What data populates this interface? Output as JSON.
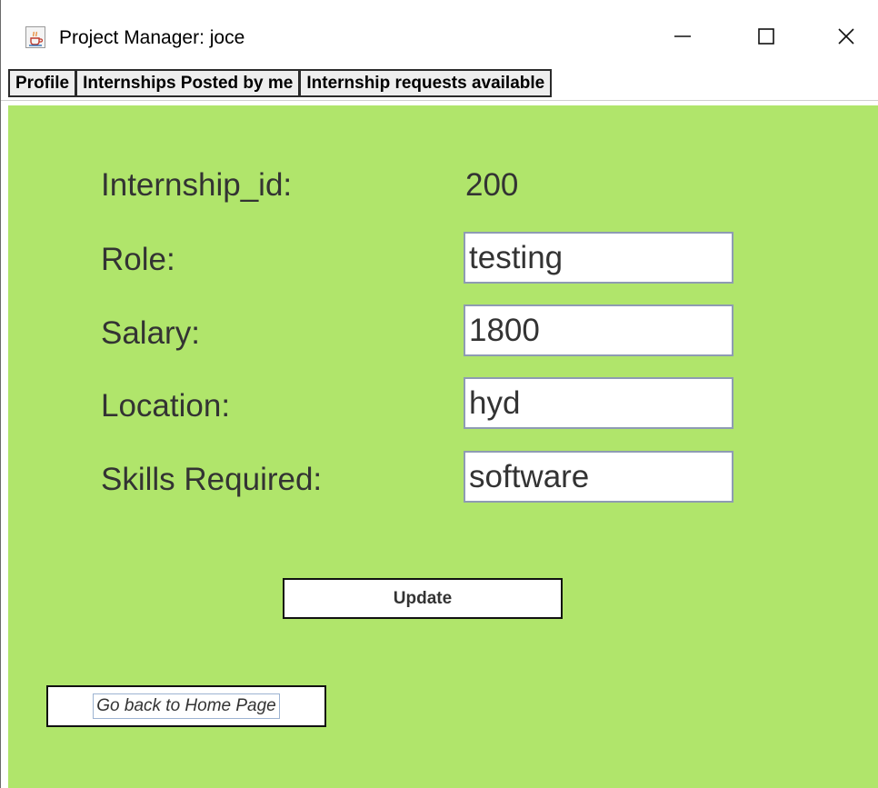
{
  "window": {
    "title": "Project Manager: joce",
    "app_icon": "java-cup-icon",
    "controls": {
      "minimize_icon": "minimize-icon",
      "maximize_icon": "maximize-icon",
      "close_icon": "close-icon"
    }
  },
  "menubar": {
    "items": [
      {
        "label": "Profile"
      },
      {
        "label": "Internships Posted by me"
      },
      {
        "label": "Internship requests available"
      }
    ]
  },
  "form": {
    "background_color": "#b0e56b",
    "internship_id": {
      "label": "Internship_id:",
      "value": "200"
    },
    "role": {
      "label": "Role:",
      "value": "testing"
    },
    "salary": {
      "label": "Salary:",
      "value": "1800"
    },
    "location": {
      "label": "Location:",
      "value": "hyd"
    },
    "skills": {
      "label": "Skills Required:",
      "value": "software"
    },
    "update_label": "Update",
    "home_label": "Go back to Home Page"
  }
}
